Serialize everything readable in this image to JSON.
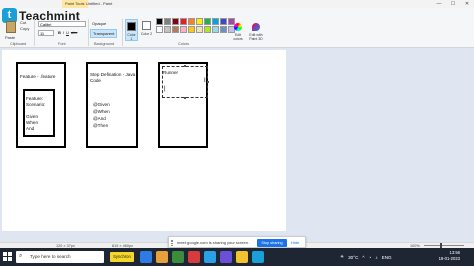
{
  "window": {
    "title": "Untitled - Paint",
    "paint_tools_tab": "Paint Tools",
    "controls": [
      "—",
      "☐",
      "✕"
    ]
  },
  "logo": {
    "mark": "t",
    "name": "Teachmint"
  },
  "ribbon": {
    "clipboard": {
      "paste": "Paste",
      "cut": "Cut",
      "copy": "Copy"
    },
    "font": {
      "name": "Calibri",
      "size": "11",
      "bold": "B",
      "italic": "I",
      "underline": "U",
      "strike": "abc"
    },
    "background": {
      "opaque": "Opaque",
      "transparent": "Transparent"
    },
    "color1_label": "Color 1",
    "color2_label": "Color 2",
    "edit_colors_label": "Edit colors",
    "paint3d_label": "Edit with Paint 3D",
    "groups": {
      "clipboard": "Clipboard",
      "font": "Font",
      "background": "Background",
      "colors": "Colors"
    }
  },
  "palette": [
    "#000000",
    "#7f7f7f",
    "#880015",
    "#ed1c24",
    "#ff7f27",
    "#fff200",
    "#22b14c",
    "#00a2e8",
    "#3f48cc",
    "#a349a4",
    "#ffffff",
    "#c3c3c3",
    "#b97a57",
    "#ffaec9",
    "#ffc90e",
    "#efe4b0",
    "#b5e61d",
    "#99d9ea",
    "#7092be",
    "#c8bfe7"
  ],
  "canvas": {
    "sheet1": {
      "title": "Feature - .feature",
      "inner_lines": [
        "Feature:",
        "Scenario:",
        "",
        "Given",
        "When",
        "And"
      ]
    },
    "sheet2": {
      "title_lines": [
        "Step Defination - Java",
        "Code"
      ],
      "lines": [
        "@Given",
        "@When",
        "@And",
        "@Then"
      ]
    },
    "sheet3": {
      "title": "Runner"
    }
  },
  "statusbar": {
    "cursor_pos": "120 × 37px",
    "canvas_size": "819 × 460px",
    "zoom": "100%"
  },
  "sharebar": {
    "message": "meet.google.com is sharing your screen.",
    "stop_label": "Stop sharing",
    "hide_label": "Hide"
  },
  "taskbar": {
    "search_placeholder": "Type here to search",
    "sync_label": "Synchron",
    "apps": [
      "#2d7be5",
      "#e8a13a",
      "#3b8d3b",
      "#d83b3b",
      "#2aa0e6",
      "#6b4fd6",
      "#f2c230",
      "#1aa0d8"
    ],
    "weather": "30°C",
    "language": "ENG",
    "time": "13:56",
    "date": "18-01-2023"
  }
}
